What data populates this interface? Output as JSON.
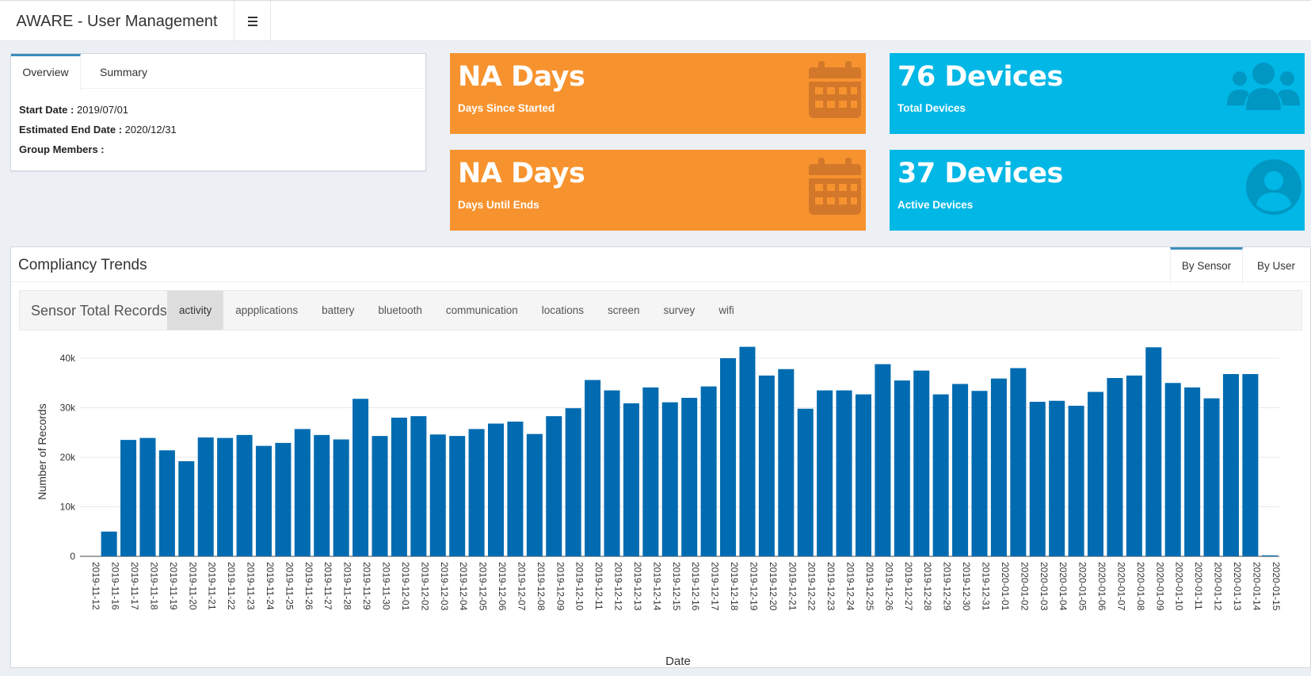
{
  "header": {
    "title": "AWARE - User Management",
    "menu_icon": "hamburger-icon"
  },
  "info": {
    "tabs": [
      "Overview",
      "Summary"
    ],
    "start_label": "Start Date : ",
    "start_value": "2019/07/01",
    "end_label": "Estimated End Date : ",
    "end_value": "2020/12/31",
    "members_label": "Group Members : "
  },
  "stats": [
    {
      "value": "NA Days",
      "label": "Days Since Started",
      "icon": "calendar-icon",
      "color": "#f7932f"
    },
    {
      "value": "76 Devices",
      "label": "Total Devices",
      "icon": "users-icon",
      "color": "#00b7e6"
    },
    {
      "value": "NA Days",
      "label": "Days Until Ends",
      "icon": "calendar-icon",
      "color": "#f7932f"
    },
    {
      "value": "37 Devices",
      "label": "Active Devices",
      "icon": "user-circle-icon",
      "color": "#00b7e6"
    }
  ],
  "compliancy": {
    "title": "Compliancy Trends",
    "views": [
      "By Sensor",
      "By User"
    ],
    "sensor_title": "Sensor Total Records",
    "sensor_tabs": [
      "activity",
      "appplications",
      "battery",
      "bluetooth",
      "communication",
      "locations",
      "screen",
      "survey",
      "wifi"
    ],
    "active_sensor": "activity"
  },
  "chart_data": {
    "type": "bar",
    "xlabel": "Date",
    "ylabel": "Number of Records",
    "ylim": [
      0,
      44000
    ],
    "yticks": [
      0,
      10000,
      20000,
      30000,
      40000
    ],
    "ytick_labels": [
      "0",
      "10k",
      "20k",
      "30k",
      "40k"
    ],
    "color": "#006bb0",
    "grid": true,
    "categories": [
      "2019-11-12",
      "2019-11-16",
      "2019-11-17",
      "2019-11-18",
      "2019-11-19",
      "2019-11-20",
      "2019-11-21",
      "2019-11-22",
      "2019-11-23",
      "2019-11-24",
      "2019-11-25",
      "2019-11-26",
      "2019-11-27",
      "2019-11-28",
      "2019-11-29",
      "2019-11-30",
      "2019-12-01",
      "2019-12-02",
      "2019-12-03",
      "2019-12-04",
      "2019-12-05",
      "2019-12-06",
      "2019-12-07",
      "2019-12-08",
      "2019-12-09",
      "2019-12-10",
      "2019-12-11",
      "2019-12-12",
      "2019-12-13",
      "2019-12-14",
      "2019-12-15",
      "2019-12-16",
      "2019-12-17",
      "2019-12-18",
      "2019-12-19",
      "2019-12-20",
      "2019-12-21",
      "2019-12-22",
      "2019-12-23",
      "2019-12-24",
      "2019-12-25",
      "2019-12-26",
      "2019-12-27",
      "2019-12-28",
      "2019-12-29",
      "2019-12-30",
      "2019-12-31",
      "2020-01-01",
      "2020-01-02",
      "2020-01-03",
      "2020-01-04",
      "2020-01-05",
      "2020-01-06",
      "2020-01-07",
      "2020-01-08",
      "2020-01-09",
      "2020-01-10",
      "2020-01-11",
      "2020-01-12",
      "2020-01-13",
      "2020-01-14",
      "2020-01-15"
    ],
    "values": [
      0,
      5000,
      23500,
      23900,
      21400,
      19200,
      24000,
      23900,
      24500,
      22300,
      22900,
      25700,
      24500,
      23600,
      31800,
      24300,
      28000,
      28300,
      24600,
      24300,
      25700,
      26800,
      27200,
      24700,
      28300,
      29900,
      35600,
      33500,
      30900,
      34100,
      31100,
      32000,
      34300,
      40000,
      42300,
      36500,
      37800,
      29800,
      33500,
      33500,
      32700,
      38800,
      35500,
      37500,
      32700,
      34800,
      33400,
      35900,
      38000,
      31200,
      31400,
      30400,
      33200,
      36000,
      36500,
      42200,
      35000,
      34100,
      31900,
      36800,
      36800,
      200
    ]
  }
}
